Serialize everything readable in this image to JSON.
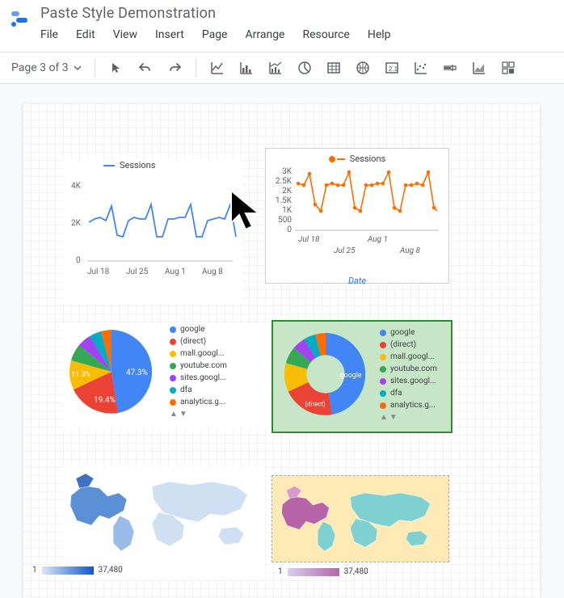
{
  "app": {
    "title": "Paste Style Demonstration"
  },
  "menu": {
    "file": "File",
    "edit": "Edit",
    "view": "View",
    "insert": "Insert",
    "page": "Page",
    "arrange": "Arrange",
    "resource": "Resource",
    "help": "Help"
  },
  "toolbar": {
    "page_label": "Page 3 of 3"
  },
  "chart_data": [
    {
      "id": "line1",
      "type": "line",
      "title": "",
      "legend": [
        "Sessions"
      ],
      "y_ticks": [
        0,
        2000,
        4000
      ],
      "y_tick_labels": [
        "0",
        "2K",
        "4K"
      ],
      "x_labels": [
        "Jul 18",
        "Jul 25",
        "Aug 1",
        "Aug 8"
      ],
      "series": [
        {
          "name": "Sessions",
          "color": "#4285f4",
          "values": [
            2200,
            2400,
            2500,
            2300,
            3000,
            1900,
            1800,
            2300,
            2500,
            2400,
            2400,
            3100,
            1800,
            1800,
            2400,
            2400,
            2500,
            2500,
            3100,
            1800,
            1800,
            2300,
            2400,
            2500,
            2400,
            3100,
            1800
          ]
        }
      ]
    },
    {
      "id": "line2",
      "type": "line",
      "title": "",
      "legend": [
        "Sessions"
      ],
      "xlabel": "Date",
      "y_ticks": [
        0,
        500,
        1000,
        1500,
        2000,
        2500,
        3000
      ],
      "y_tick_labels": [
        "0",
        "500",
        "1K",
        "1.5K",
        "2K",
        "2.5K",
        "3K"
      ],
      "x_labels": [
        "Jul 18",
        "Jul 25",
        "Aug 1",
        "Aug 8"
      ],
      "series": [
        {
          "name": "Sessions",
          "color": "#ff6d00",
          "values": [
            2500,
            2400,
            3000,
            1600,
            1300,
            2300,
            2500,
            2400,
            2400,
            3100,
            1500,
            1300,
            2400,
            2400,
            2500,
            2500,
            3100,
            1500,
            1300,
            2300,
            2400,
            2500,
            2400,
            3100,
            1500,
            1300,
            2900
          ]
        }
      ]
    },
    {
      "id": "pie1",
      "type": "pie",
      "segments": [
        {
          "label": "google",
          "value": 47.3,
          "color": "#4285f4",
          "value_label": "47.3%"
        },
        {
          "label": "(direct)",
          "value": 19.4,
          "color": "#ea4335",
          "value_label": "19.4%"
        },
        {
          "label": "mall.googl...",
          "value": 11.3,
          "color": "#fbbc04",
          "value_label": "11.3%"
        },
        {
          "label": "youtube.com",
          "value": 7,
          "color": "#34a853"
        },
        {
          "label": "sites.googl...",
          "value": 5,
          "color": "#a142f4"
        },
        {
          "label": "dfa",
          "value": 5,
          "color": "#00acc1"
        },
        {
          "label": "analytics.g...",
          "value": 5,
          "color": "#ff6d00"
        }
      ]
    },
    {
      "id": "pie2",
      "type": "donut",
      "center_label": "google",
      "segments": [
        {
          "label": "google",
          "value": 47.3,
          "color": "#4285f4"
        },
        {
          "label": "(direct)",
          "value": 19.4,
          "color": "#ea4335",
          "value_label": "(direct)"
        },
        {
          "label": "mall.googl...",
          "value": 11.3,
          "color": "#fbbc04"
        },
        {
          "label": "youtube.com",
          "value": 7,
          "color": "#34a853"
        },
        {
          "label": "sites.googl...",
          "value": 5,
          "color": "#a142f4"
        },
        {
          "label": "dfa",
          "value": 5,
          "color": "#00acc1"
        },
        {
          "label": "analytics.g...",
          "value": 5,
          "color": "#ff6d00"
        }
      ]
    },
    {
      "id": "map1",
      "type": "geo-map",
      "scale_min": "1",
      "scale_max": "37,480",
      "palette": "blue"
    },
    {
      "id": "map2",
      "type": "geo-map",
      "scale_min": "1",
      "scale_max": "37,480",
      "palette": "teal-purple"
    }
  ]
}
